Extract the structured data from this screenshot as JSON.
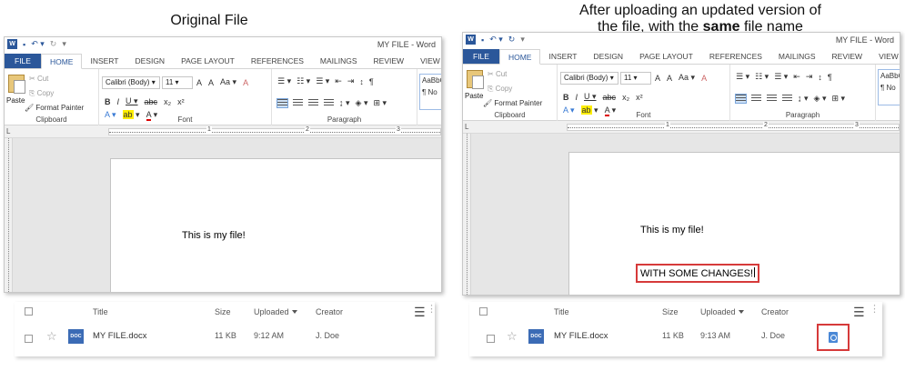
{
  "captions": {
    "left": "Original File",
    "right_line1": "After uploading an updated version of",
    "right_line2_pre": "the file, with the ",
    "right_line2_bold": "same",
    "right_line2_post": " file name"
  },
  "word": {
    "window_title": "MY FILE - Word",
    "tabs": [
      "FILE",
      "HOME",
      "INSERT",
      "DESIGN",
      "PAGE LAYOUT",
      "REFERENCES",
      "MAILINGS",
      "REVIEW",
      "VIEW"
    ],
    "active_tab": "HOME",
    "clipboard": {
      "paste": "Paste",
      "cut": "Cut",
      "copy": "Copy",
      "format_painter": "Format Painter",
      "label": "Clipboard"
    },
    "font": {
      "name": "Calibri (Body)",
      "size": "11",
      "label": "Font"
    },
    "paragraph_label": "Paragraph",
    "styles_preview": "AaBbC",
    "styles_normal": "¶ No",
    "ruler_numbers": [
      "1",
      "2",
      "3"
    ]
  },
  "original": {
    "doc_text": "This is my file!"
  },
  "updated": {
    "doc_text": "This is my file!",
    "doc_changes": "WITH SOME CHANGES!"
  },
  "filelist": {
    "headers": {
      "title": "Title",
      "size": "Size",
      "uploaded": "Uploaded",
      "creator": "Creator"
    },
    "original_row": {
      "badge": "DOC",
      "name": "MY FILE.docx",
      "size": "11 KB",
      "uploaded": "9:12 AM",
      "creator": "J. Doe"
    },
    "updated_row": {
      "badge": "DOC",
      "name": "MY FILE.docx",
      "size": "11 KB",
      "uploaded": "9:13 AM",
      "creator": "J. Doe"
    }
  },
  "colors": {
    "word_blue": "#2b579a",
    "highlight_red": "#d63a3a"
  }
}
